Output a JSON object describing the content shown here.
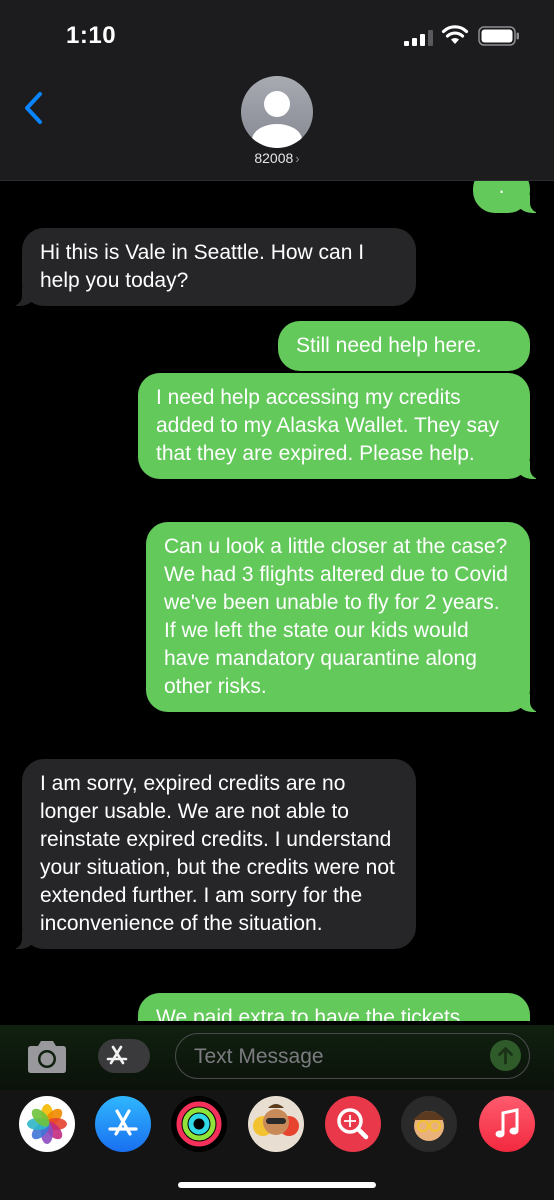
{
  "status_bar": {
    "time": "1:10"
  },
  "header": {
    "contact_name": "82008",
    "chevron": "›"
  },
  "messages": [
    {
      "from": "me",
      "text": "."
    },
    {
      "from": "them",
      "text": "Hi this is Vale in Seattle. How can I help you today?"
    },
    {
      "from": "me",
      "text": "Still need help here."
    },
    {
      "from": "me",
      "text": "I need help accessing my credits added to my Alaska Wallet. They say that they are expired. Please help."
    },
    {
      "from": "me",
      "text": "Can u look a little closer at the case? We had 3 flights altered due to Covid we've been unable to fly for 2 years. If we left the state our kids would have mandatory quarantine along other risks."
    },
    {
      "from": "them",
      "text": "I am sorry, expired credits are no longer usable. We are not able to reinstate expired credits. I understand your situation, but the credits were not extended further. I am sorry for the inconvenience of the situation."
    },
    {
      "from": "me",
      "text": "We paid extra to have the tickets"
    }
  ],
  "input_bar": {
    "placeholder": "Text Message"
  },
  "app_drawer": [
    "photos-app-icon",
    "app-store-icon",
    "activity-icon",
    "memoji-stickers-icon",
    "search-images-icon",
    "memoji-icon",
    "music-icon"
  ],
  "colors": {
    "outgoing": "#63c95b",
    "incoming": "#262629",
    "accent": "#0a84ff"
  }
}
